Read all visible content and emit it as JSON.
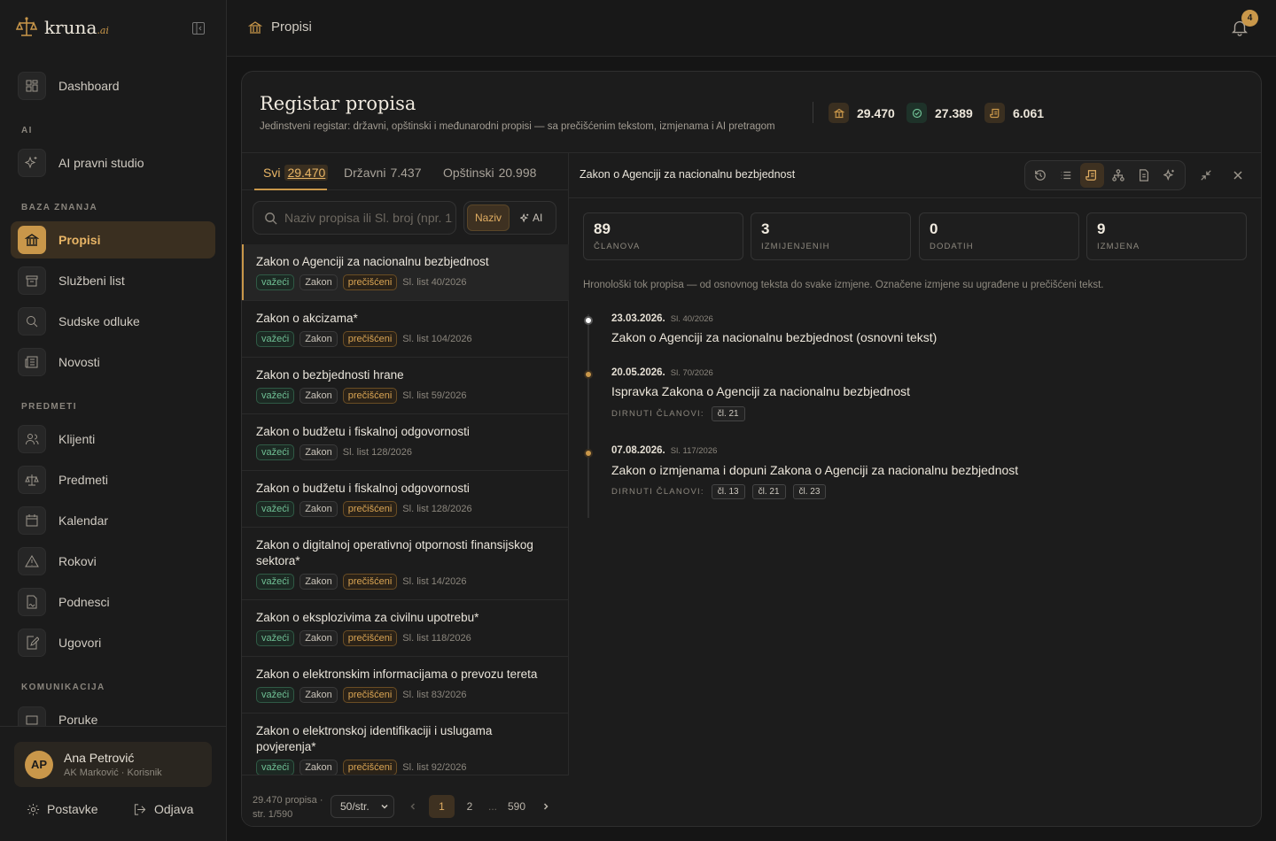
{
  "brand": {
    "name": "kruna",
    "suffix": ".ai"
  },
  "sidebar": {
    "dashboard": "Dashboard",
    "sec_ai": "AI",
    "ai_studio": "AI pravni studio",
    "sec_baza": "BAZA ZNANJA",
    "propisi": "Propisi",
    "sluzbeni": "Službeni list",
    "sudske": "Sudske odluke",
    "novosti": "Novosti",
    "sec_predmeti": "PREDMETI",
    "klijenti": "Klijenti",
    "predmeti": "Predmeti",
    "kalendar": "Kalendar",
    "rokovi": "Rokovi",
    "podnesci": "Podnesci",
    "ugovori": "Ugovori",
    "sec_kom": "KOMUNIKACIJA",
    "poruke": "Poruke"
  },
  "user": {
    "initials": "AP",
    "name": "Ana Petrović",
    "sub": "AK Marković · Korisnik"
  },
  "footer": {
    "settings": "Postavke",
    "logout": "Odjava"
  },
  "topbar": {
    "crumb": "Propisi",
    "notif_count": "4"
  },
  "header": {
    "title": "Registar propisa",
    "subtitle": "Jedinstveni registar: državni, opštinski i međunarodni propisi — sa prečišćenim tekstom, izmjenama i AI pretragom",
    "stat1": "29.470",
    "stat2": "27.389",
    "stat3": "6.061"
  },
  "tabs": [
    {
      "label": "Svi",
      "count": "29.470"
    },
    {
      "label": "Državni",
      "count": "7.437"
    },
    {
      "label": "Opštinski",
      "count": "20.998"
    }
  ],
  "search": {
    "placeholder": "Naziv propisa ili Sl. broj (npr. 12/2020)"
  },
  "mode": {
    "naziv": "Naziv",
    "ai": "AI"
  },
  "list": [
    {
      "title": "Zakon o Agenciji za nacionalnu bezbjednost",
      "status": "važeći",
      "type": "Zakon",
      "clean": "prečišćeni",
      "sl": "Sl. list 40/2026"
    },
    {
      "title": "Zakon o akcizama*",
      "status": "važeći",
      "type": "Zakon",
      "clean": "prečišćeni",
      "sl": "Sl. list 104/2026"
    },
    {
      "title": "Zakon o bezbjednosti hrane",
      "status": "važeći",
      "type": "Zakon",
      "clean": "prečišćeni",
      "sl": "Sl. list 59/2026"
    },
    {
      "title": "Zakon o budžetu i fiskalnoj odgovornosti",
      "status": "važeći",
      "type": "Zakon",
      "clean": "",
      "sl": "Sl. list 128/2026"
    },
    {
      "title": "Zakon o budžetu i fiskalnoj odgovornosti",
      "status": "važeći",
      "type": "Zakon",
      "clean": "prečišćeni",
      "sl": "Sl. list 128/2026"
    },
    {
      "title": "Zakon o digitalnoj operativnoj otpornosti finansijskog sektora*",
      "status": "važeći",
      "type": "Zakon",
      "clean": "prečišćeni",
      "sl": "Sl. list 14/2026"
    },
    {
      "title": "Zakon o eksplozivima za civilnu upotrebu*",
      "status": "važeći",
      "type": "Zakon",
      "clean": "prečišćeni",
      "sl": "Sl. list 118/2026"
    },
    {
      "title": "Zakon o elektronskim informacijama o prevozu tereta",
      "status": "važeći",
      "type": "Zakon",
      "clean": "prečišćeni",
      "sl": "Sl. list 83/2026"
    },
    {
      "title": "Zakon o elektronskoj identifikaciji i uslugama povjerenja*",
      "status": "važeći",
      "type": "Zakon",
      "clean": "prečišćeni",
      "sl": "Sl. list 92/2026"
    }
  ],
  "pager": {
    "info1": "29.470 propisa ·",
    "info2": "str. 1/590",
    "per_page": "50/str.",
    "p1": "1",
    "p2": "2",
    "dots": "...",
    "last": "590"
  },
  "detail": {
    "title": "Zakon o Agenciji za nacionalnu bezbjednost",
    "cards": [
      {
        "n": "89",
        "l": "ČLANOVA"
      },
      {
        "n": "3",
        "l": "IZMIJENJENIH"
      },
      {
        "n": "0",
        "l": "DODATIH"
      },
      {
        "n": "9",
        "l": "IZMJENA"
      }
    ],
    "intro": "Hronološki tok propisa — od osnovnog teksta do svake izmjene. Označene izmjene su ugrađene u prečišćeni tekst.",
    "dirn_label": "DIRNUTI ČLANOVI:",
    "timeline": [
      {
        "date": "23.03.2026.",
        "sl": "Sl. 40/2026",
        "name": "Zakon o Agenciji za nacionalnu bezbjednost (osnovni tekst)",
        "chips": []
      },
      {
        "date": "20.05.2026.",
        "sl": "Sl. 70/2026",
        "name": "Ispravka Zakona o Agenciji za nacionalnu bezbjednost",
        "chips": [
          "čl. 21"
        ]
      },
      {
        "date": "07.08.2026.",
        "sl": "Sl. 117/2026",
        "name": "Zakon o izmjenama i dopuni Zakona o Agenciji za nacionalnu bezbjednost",
        "chips": [
          "čl. 13",
          "čl. 21",
          "čl. 23"
        ]
      }
    ]
  },
  "colors": {
    "accent": "#c9974a",
    "bg": "#151515",
    "green": "#6fbf94"
  }
}
